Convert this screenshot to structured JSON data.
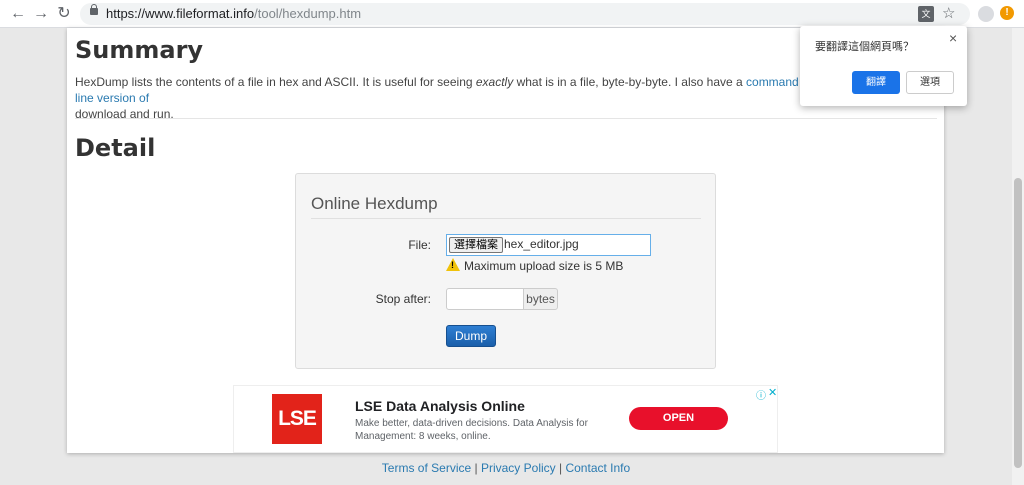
{
  "browser": {
    "url_host": "https://www.fileformat.info",
    "url_path": "/tool/hexdump.htm",
    "icons": [
      "back-icon",
      "forward-icon",
      "reload-icon",
      "lock-icon",
      "translate-icon",
      "star-icon",
      "profile-icon",
      "extension-icon"
    ],
    "ext_badge": "!"
  },
  "summary": {
    "title": "Summary",
    "text_before": "HexDump lists the contents of a file in hex and ASCII. It is useful for seeing ",
    "text_em": "exactly",
    "text_after": " what is in a file, byte-by-byte. I also have a ",
    "link": "command line version of",
    "text_end": "download and run."
  },
  "detail": {
    "title": "Detail"
  },
  "hexdump": {
    "title": "Online Hexdump",
    "file_label": "File:",
    "choose_button": "選擇檔案",
    "file_name": "hex_editor.jpg",
    "warning": "Maximum upload size is 5 MB",
    "stop_label": "Stop after:",
    "stop_value": "",
    "stop_unit": "bytes",
    "dump_button": "Dump"
  },
  "ad": {
    "logo_text": "LSE",
    "title": "LSE Data Analysis Online",
    "description": "Make better, data-driven decisions. Data Analysis for Management: 8 weeks, online.",
    "cta": "OPEN",
    "accent": "#e2231a"
  },
  "footer": {
    "links": [
      "Terms of Service",
      "Privacy Policy",
      "Contact Info"
    ],
    "separator": "|"
  },
  "translate_popup": {
    "question": "要翻譯這個網頁嗎？",
    "translate_button": "翻譯",
    "options_button": "選項",
    "close": "×"
  }
}
